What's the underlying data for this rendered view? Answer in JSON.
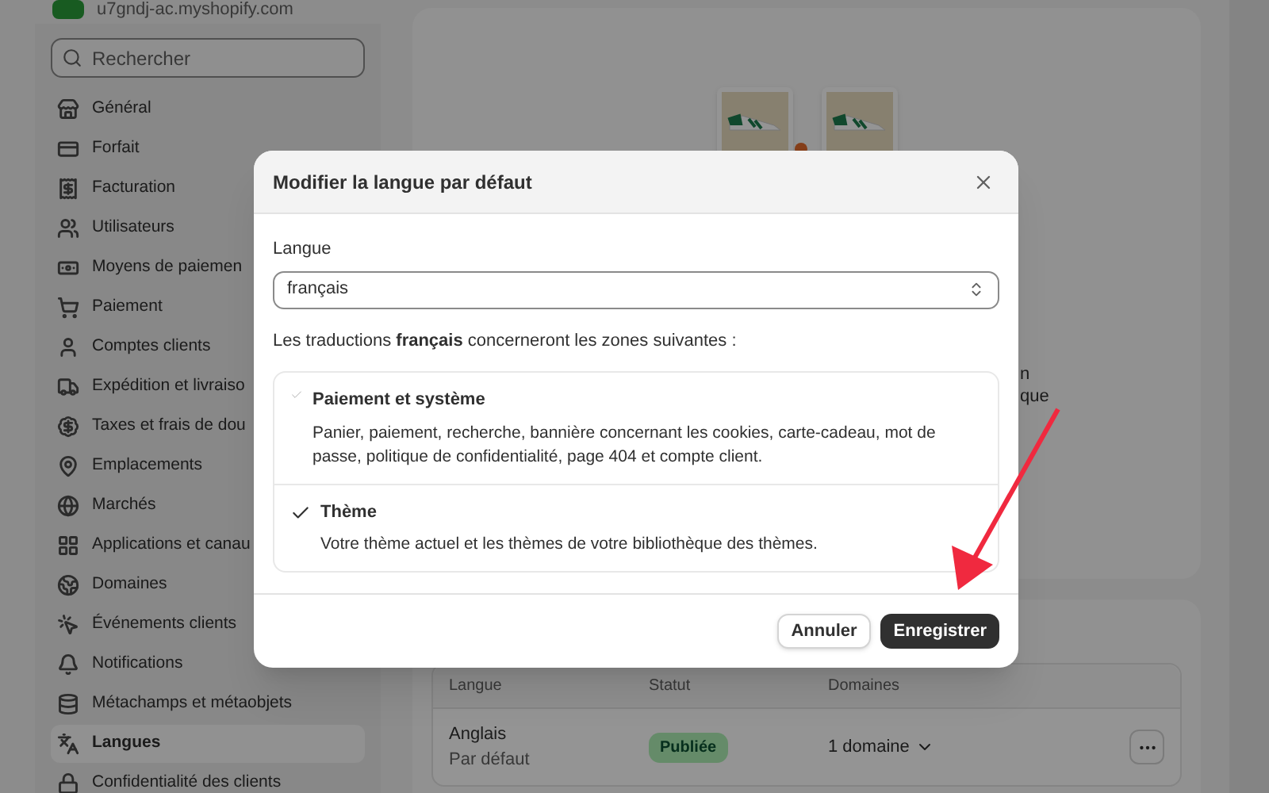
{
  "store": {
    "domain": "u7gndj-ac.myshopify.com"
  },
  "sidebar": {
    "search": {
      "placeholder": "Rechercher"
    },
    "items": [
      {
        "label": "Général",
        "selected": false
      },
      {
        "label": "Forfait",
        "selected": false
      },
      {
        "label": "Facturation",
        "selected": false
      },
      {
        "label": "Utilisateurs",
        "selected": false
      },
      {
        "label": "Moyens de paiemen",
        "selected": false
      },
      {
        "label": "Paiement",
        "selected": false
      },
      {
        "label": "Comptes clients",
        "selected": false
      },
      {
        "label": "Expédition et livraiso",
        "selected": false
      },
      {
        "label": "Taxes et frais de dou",
        "selected": false
      },
      {
        "label": "Emplacements",
        "selected": false
      },
      {
        "label": "Marchés",
        "selected": false
      },
      {
        "label": "Applications et canau",
        "selected": false
      },
      {
        "label": "Domaines",
        "selected": false
      },
      {
        "label": "Événements clients",
        "selected": false
      },
      {
        "label": "Notifications",
        "selected": false
      },
      {
        "label": "Métachamps et métaobjets",
        "selected": false
      },
      {
        "label": "Langues",
        "selected": true
      },
      {
        "label": "Confidentialité des clients",
        "selected": false
      }
    ]
  },
  "hero_card": {
    "text_fragments": [
      "n",
      "que"
    ]
  },
  "languages_table": {
    "columns": [
      "Langue",
      "Statut",
      "Domaines"
    ],
    "rows": [
      {
        "language": "Anglais",
        "note": "Par défaut",
        "status": "Publiée",
        "domains": "1 domaine"
      }
    ]
  },
  "dialog": {
    "title": "Modifier la langue par défaut",
    "field_label": "Langue",
    "field_value": "français",
    "intro": "Les traductions **français** concerneront les zones suivantes :",
    "zones": [
      {
        "title": "Paiement et système",
        "description": "Panier, paiement, recherche, bannière concernant les cookies, carte-cadeau, mot de passe, politique de confidentialité, page 404 et compte client.",
        "disabled": true
      },
      {
        "title": "Thème",
        "description": "Votre thème actuel et les thèmes de votre bibliothèque des thèmes.",
        "disabled": false
      }
    ],
    "buttons": [
      {
        "label": "Annuler",
        "kind": "secondary"
      },
      {
        "label": "Enregistrer",
        "kind": "primary"
      }
    ]
  }
}
